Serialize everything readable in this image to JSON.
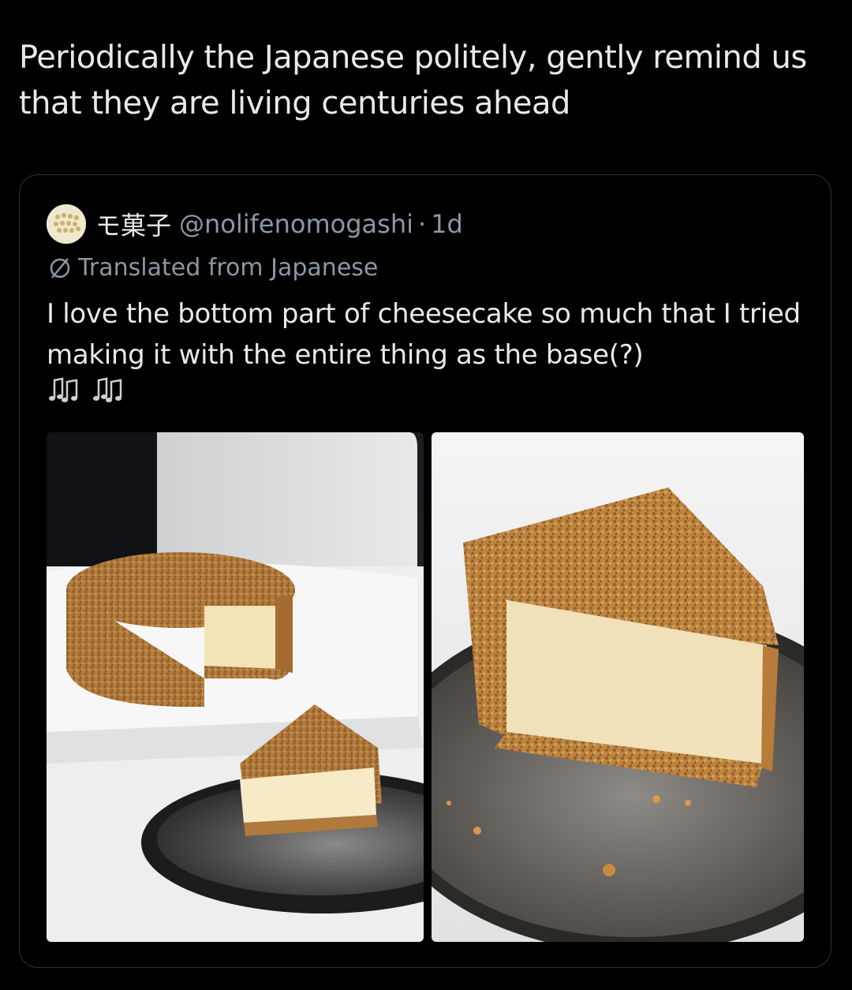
{
  "post": {
    "text": "Periodically the Japanese politely, gently remind us that they are living centuries ahead"
  },
  "quoted": {
    "display_name": "モ菓子",
    "handle": "@nolifenomogashi",
    "separator": "·",
    "age": "1d",
    "translated_label": "Translated from Japanese",
    "body": "I love the bottom part of cheesecake so much that I tried making it with the entire thing as the base(?)",
    "emoji": [
      "music-notes-icon",
      "music-notes-icon"
    ],
    "photos": [
      {
        "name": "whole-cheesecake-photo"
      },
      {
        "name": "cheesecake-slice-photo"
      }
    ]
  },
  "colors": {
    "background": "#000000",
    "text": "#e7e9ea",
    "muted": "#8b98a5",
    "border": "#2f3336"
  }
}
